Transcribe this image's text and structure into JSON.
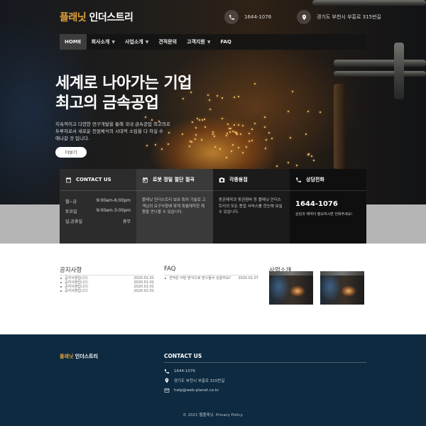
{
  "header": {
    "brand_accent": "플래닛",
    "brand_rest": " 인더스트리",
    "phone": "1644-1076",
    "address": "경기도 부천시 부흥로 315번길",
    "phone_icon": "phone-icon",
    "location_icon": "location-pin-icon"
  },
  "nav": {
    "items": [
      {
        "label": "HOME",
        "dropdown": false,
        "active": true
      },
      {
        "label": "회사소개",
        "dropdown": true
      },
      {
        "label": "사업소개",
        "dropdown": true
      },
      {
        "label": "견적문의",
        "dropdown": false
      },
      {
        "label": "고객지원",
        "dropdown": true
      },
      {
        "label": "FAQ",
        "dropdown": false
      }
    ]
  },
  "hero": {
    "title_line1": "세계로 나아가는 기업",
    "title_line2": "최고의 금속공업",
    "desc_line1": "지속적이고 다양한 연구개발을 통해 국내 금속공업 최고의로",
    "desc_line2": "두루자로서 새로운 천원체식의 시대적 소임을 다 하실 수",
    "desc_line3": "애나갈 것 입니다.",
    "more_button": "더보기"
  },
  "boxes": {
    "contact": {
      "title": "CONTACT US",
      "icon": "calendar-icon",
      "rows": [
        {
          "day": "월~금",
          "time": "9:00am-6:00pm"
        },
        {
          "day": "토요일",
          "time": "9:00am-3:00pm"
        },
        {
          "day": "일,공휴일",
          "time": "휴무"
        }
      ]
    },
    "robot": {
      "title": "로봇 정밀 절단 절곡",
      "icon": "calendar-icon",
      "text": "플래닛 인더스트리 보유 특허 기술로 고객님의 요구사항에 맞게 특별제작한 제품을 만나볼 수 있습니다."
    },
    "welding": {
      "title": "각종용접",
      "icon": "camera-icon",
      "text": "동관제작과 동관첨바 등 플래닛 인더스트리의 모든 용접 서비스를 한눈에 보실 수 있습니다."
    },
    "call": {
      "title": "상담전화",
      "icon": "phone-icon",
      "phone": "1644-1076",
      "note": "상담과 예약이 필요하시면 전화주세요!"
    }
  },
  "notice": {
    "title": "공지사항",
    "items": [
      {
        "text": "공지사항입니다.",
        "date": "2020.01.01"
      },
      {
        "text": "공지사항입니다.",
        "date": "2020.01.01"
      },
      {
        "text": "공지사항입니다.",
        "date": "2020.01.01"
      },
      {
        "text": "공지사항입니다.",
        "date": "2020.01.01"
      }
    ]
  },
  "faq": {
    "title": "FAQ",
    "items": [
      {
        "text": "견적은 어떤 방식으로 받으들수 있을까요?",
        "date": "2020.01.07"
      }
    ]
  },
  "business": {
    "title": "사업소개"
  },
  "footer": {
    "brand_accent": "플래닛",
    "brand_rest": " 인더스트리",
    "contact_title": "CONTACT US",
    "phone": "1644-1076",
    "address": "경기도 부천시 부흥로 315번길",
    "email": "help@web-planet.co.kr",
    "copyright": "© 2021 웹플래닛. Privacy Policy."
  }
}
